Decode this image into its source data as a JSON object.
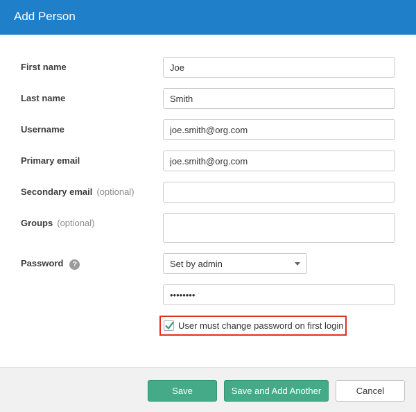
{
  "dialog": {
    "title": "Add Person"
  },
  "form": {
    "first_name": {
      "label": "First name",
      "value": "Joe"
    },
    "last_name": {
      "label": "Last name",
      "value": "Smith"
    },
    "username": {
      "label": "Username",
      "value": "joe.smith@org.com"
    },
    "primary_email": {
      "label": "Primary email",
      "value": "joe.smith@org.com"
    },
    "secondary_email": {
      "label": "Secondary email",
      "optional": "(optional)",
      "value": ""
    },
    "groups": {
      "label": "Groups",
      "optional": "(optional)"
    },
    "password": {
      "label": "Password",
      "help": "?",
      "mode": "Set by admin",
      "value": "••••••••"
    },
    "must_change": {
      "label": "User must change password on first login",
      "checked": true
    }
  },
  "footer": {
    "save": "Save",
    "save_add_another": "Save and Add Another",
    "cancel": "Cancel"
  },
  "colors": {
    "header": "#1f80c9",
    "primary_button": "#44aa88",
    "highlight": "#e0301e",
    "checkmark": "#2a9d77"
  }
}
